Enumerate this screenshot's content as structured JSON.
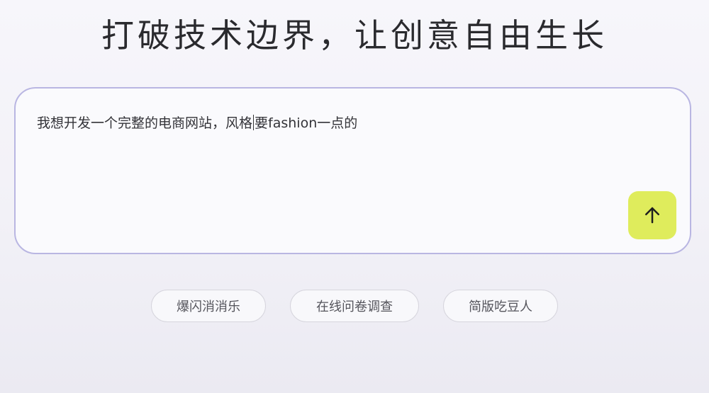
{
  "headline": "打破技术边界，让创意自由生长",
  "composer": {
    "text_before_caret": "我想开发一个完整的电商网站，风格",
    "text_after_caret": "要fashion一点的",
    "send_icon": "arrow-up-icon",
    "send_color": "#dfec5c"
  },
  "suggestions": [
    {
      "label": "爆闪消消乐"
    },
    {
      "label": "在线问卷调查"
    },
    {
      "label": "简版吃豆人"
    }
  ]
}
